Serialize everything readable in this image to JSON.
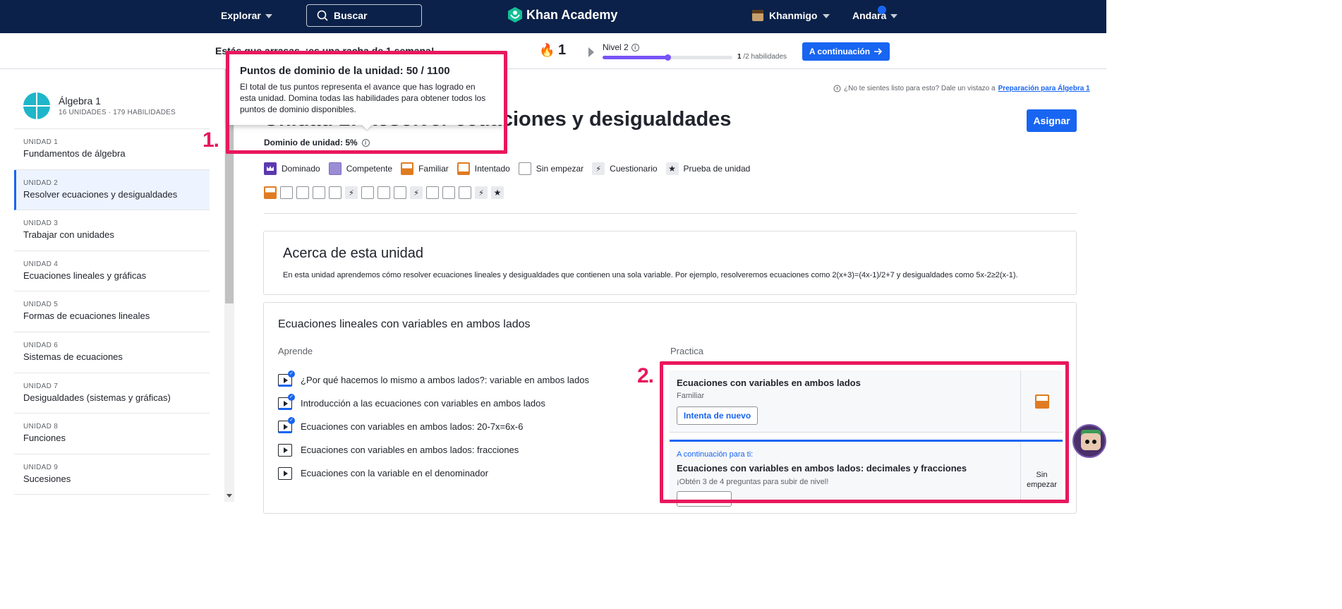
{
  "nav": {
    "explore": "Explorar",
    "search_placeholder": "Buscar",
    "logo": "Khan Academy",
    "khanmigo": "Khanmigo",
    "user": "Andara"
  },
  "streak": {
    "text": "Estás que arrasas, ¡es una racha de 1 semana!",
    "count": "1",
    "level": "Nivel 2",
    "level_progress": 0.5,
    "skills_done": "1",
    "skills_total": " /2 habilidades",
    "next_button": "A continuación"
  },
  "sidebar": {
    "course_title": "Álgebra 1",
    "course_sub": "16 UNIDADES · 179 HABILIDADES",
    "units": [
      {
        "num": "UNIDAD 1",
        "name": "Fundamentos de álgebra"
      },
      {
        "num": "UNIDAD 2",
        "name": "Resolver ecuaciones y desigualdades"
      },
      {
        "num": "UNIDAD 3",
        "name": "Trabajar con unidades"
      },
      {
        "num": "UNIDAD 4",
        "name": "Ecuaciones lineales y gráficas"
      },
      {
        "num": "UNIDAD 5",
        "name": "Formas de ecuaciones lineales"
      },
      {
        "num": "UNIDAD 6",
        "name": "Sistemas de ecuaciones"
      },
      {
        "num": "UNIDAD 7",
        "name": "Desigualdades (sistemas y gráficas)"
      },
      {
        "num": "UNIDAD 8",
        "name": "Funciones"
      },
      {
        "num": "UNIDAD 9",
        "name": "Sucesiones"
      }
    ]
  },
  "main": {
    "prep_note": "¿No te sientes listo para esto? Dale un vistazo a",
    "prep_link": "Preparación para Álgebra 1",
    "unit_title": "Unidad 2: Resolver ecuaciones y desigualdades",
    "assign": "Asignar",
    "mastery": "Dominio de unidad: 5%",
    "legend": {
      "mastered": "Dominado",
      "proficient": "Competente",
      "familiar": "Familiar",
      "attempted": "Intentado",
      "not_started": "Sin empezar",
      "quiz": "Cuestionario",
      "unit_test": "Prueba de unidad"
    },
    "about_title": "Acerca de esta unidad",
    "about_text": "En esta unidad aprendemos cómo resolver ecuaciones lineales y desigualdades que contienen una sola variable. Por ejemplo, resolveremos ecuaciones como 2(x+3)=(4x-1)/2+7 y desigualdades como 5x-2≥2(x-1).",
    "lesson_title": "Ecuaciones lineales con variables en ambos lados",
    "learn_label": "Aprende",
    "practice_label": "Practica",
    "learn_items": [
      "¿Por qué hacemos lo mismo a ambos lados?: variable en ambos lados",
      "Introducción a las ecuaciones con variables en ambos lados",
      "Ecuaciones con variables en ambos lados: 20-7x=6x-6",
      "Ecuaciones con variables en ambos lados: fracciones",
      "Ecuaciones con la variable en el denominador"
    ],
    "practice1": {
      "title": "Ecuaciones con variables en ambos lados",
      "status": "Familiar",
      "button": "Intenta de nuevo"
    },
    "practice2": {
      "tag": "A continuación para ti:",
      "title": "Ecuaciones con variables en ambos lados: decimales y fracciones",
      "sub": "¡Obtén 3 de 4 preguntas para subir de nivel!",
      "status": "Sin empezar"
    }
  },
  "tooltip": {
    "title": "Puntos de dominio de la unidad: 50 / 1100",
    "text": "El total de tus puntos representa el avance que has logrado en esta unidad. Domina todas las habilidades para obtener todos los puntos de dominio disponibles."
  },
  "annotations": {
    "label1": "1.",
    "label2": "2."
  },
  "colors": {
    "nav_bg": "#0b2149",
    "accent": "#1865f2",
    "familiar": "#e07b22",
    "mastered": "#5b39b0",
    "annotation": "#e8185c"
  }
}
